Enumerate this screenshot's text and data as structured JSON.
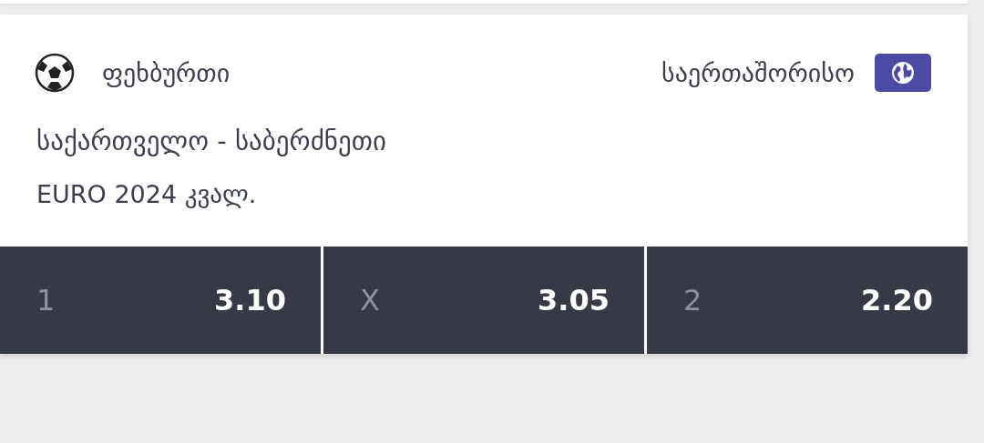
{
  "event": {
    "sport": "ფეხბურთი",
    "category": "საერთაშორისო",
    "title": "საქართველო - საბერძნეთი",
    "subtitle": "EURO 2024 კვალ.",
    "odds": [
      {
        "label": "1",
        "value": "3.10"
      },
      {
        "label": "X",
        "value": "3.05"
      },
      {
        "label": "2",
        "value": "2.20"
      }
    ]
  }
}
